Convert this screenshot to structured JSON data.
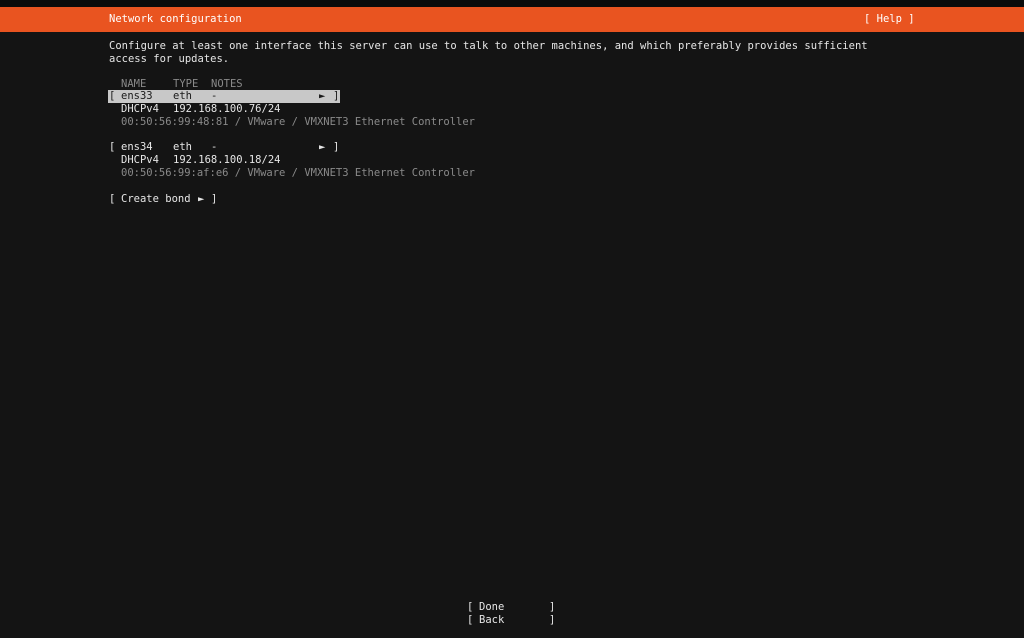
{
  "header": {
    "title": "Network configuration",
    "help": "[ Help ]"
  },
  "description": "Configure at least one interface this server can use to talk to other machines, and which preferably provides sufficient\naccess for updates.",
  "table": {
    "columns": [
      "NAME",
      "TYPE",
      "NOTES"
    ],
    "interfaces": [
      {
        "name": "ens33",
        "type": "eth",
        "notes": "-",
        "method": "DHCPv4",
        "address": "192.168.100.76/24",
        "details": "00:50:56:99:48:81 / VMware / VMXNET3 Ethernet Controller",
        "selected": true
      },
      {
        "name": "ens34",
        "type": "eth",
        "notes": "-",
        "method": "DHCPv4",
        "address": "192.168.100.18/24",
        "details": "00:50:56:99:af:e6 / VMware / VMXNET3 Ethernet Controller",
        "selected": false
      }
    ]
  },
  "create_bond": "Create bond",
  "footer": {
    "done": "Done",
    "back": "Back"
  },
  "glyphs": {
    "bracket_open": "[",
    "bracket_close": "]",
    "arrow": "►"
  },
  "colors": {
    "accent": "#e95420",
    "background": "#141414",
    "selection": "#c8c8c8"
  }
}
